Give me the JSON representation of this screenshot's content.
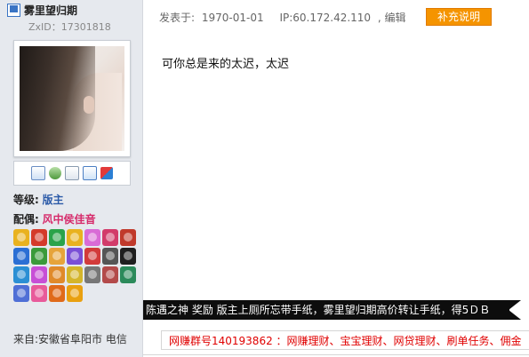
{
  "user": {
    "name": "雾里望归期",
    "zxid": "ZxID：17301818",
    "level_label": "等级:",
    "level_value": "版主",
    "spouse_label": "配偶:",
    "spouse_value": "风中侯佳音",
    "location": "来自:安徽省阜阳市 电信",
    "action_icons": [
      "mail-icon",
      "add-friend-icon",
      "search-icon",
      "profile-card-icon",
      "gift-icon"
    ],
    "medal_colors": [
      "#e9b21f",
      "#d43a2a",
      "#2aa34a",
      "#e9b21f",
      "#d96bd6",
      "#d23b6a",
      "#c0392b",
      "#2b6fd4",
      "#3a9a3a",
      "#e6a43a",
      "#7a4fd6",
      "#d23b3b",
      "#555555",
      "#1f1f1f",
      "#2b8fd4",
      "#c74fd6",
      "#e08a2a",
      "#d4b52b",
      "#777777",
      "#b34a4a",
      "#2b8a5a",
      "#4f6fd6",
      "#e85a9a",
      "#e06a1a",
      "#e9a010"
    ]
  },
  "post": {
    "meta_prefix": "发表于:",
    "date": "1970-01-01",
    "ip": "IP:60.172.42.110",
    "edit": ", 编辑",
    "supplement_button": "补充说明",
    "content": "可你总是来的太迟，太迟"
  },
  "banner": {
    "text": "陈遇之神  奖励  版主上厕所忘带手纸，雾里望归期高价转让手纸，得5ＤＢ"
  },
  "ad": {
    "text": "网赚群号140193862  ：网赚理财、宝宝理财、网贷理财、刷单任务、佣金"
  },
  "colors": {
    "sidebar_bg": "#e6e9ee",
    "level": "#2b5aa8",
    "spouse": "#d62a6a",
    "supplement_button": "#f59400",
    "banner_bg": "#0d0d0d",
    "ad_text": "#e00000"
  }
}
